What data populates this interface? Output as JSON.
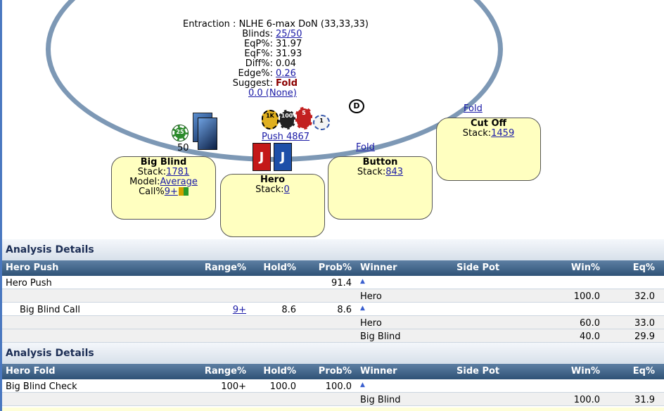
{
  "table": {
    "title_label": "Entraction :",
    "title_value": "NLHE 6-max DoN (33,33,33)",
    "stats": [
      {
        "label": "Blinds:",
        "value": "25/50",
        "link": true
      },
      {
        "label": "EqP%:",
        "value": "31.97",
        "link": false
      },
      {
        "label": "EqF%:",
        "value": "31.93",
        "link": false
      },
      {
        "label": "Diff%:",
        "value": "0.04",
        "link": false
      },
      {
        "label": "Edge%:",
        "value": "0.26",
        "link": true
      }
    ],
    "suggest_label": "Suggest:",
    "suggest_value": "Fold",
    "suggest_sub": "0.0 (None)",
    "dealer": "D",
    "push_label": "Push 4867",
    "bb_bet": "50",
    "chips": [
      "25",
      "1K",
      "100",
      "5",
      "1"
    ],
    "cards": [
      "J",
      "J"
    ],
    "colors": {
      "felt_border": "#7d98b5",
      "seat_bg": "#ffffc0",
      "link": "#1a1aa6",
      "suggest": "#8b0000"
    }
  },
  "seats": {
    "big_blind": {
      "name": "Big Blind",
      "stack_label": "Stack:",
      "stack": "1781",
      "model_label": "Model:",
      "model": "Average",
      "call_label": "Call%",
      "call": "9+"
    },
    "hero": {
      "name": "Hero",
      "stack_label": "Stack:",
      "stack": "0"
    },
    "button": {
      "name": "Button",
      "stack_label": "Stack:",
      "stack": "843",
      "action": "Fold"
    },
    "cutoff": {
      "name": "Cut Off",
      "stack_label": "Stack:",
      "stack": "1459",
      "action": "Fold"
    }
  },
  "analysis1": {
    "title": "Analysis Details",
    "headers": [
      "Hero Push",
      "Range%",
      "Hold%",
      "Prob%",
      "Winner",
      "Side Pot",
      "Win%",
      "Eq%"
    ],
    "rows": [
      {
        "c0": "Hero Push",
        "c1": "",
        "c2": "",
        "c3": "91.4",
        "c4": "▲",
        "c5": "",
        "c6": "",
        "c7": ""
      },
      {
        "c0": "",
        "c1": "",
        "c2": "",
        "c3": "",
        "c4": "Hero",
        "c5": "",
        "c6": "100.0",
        "c7": "32.0"
      },
      {
        "c0": "Big Blind Call",
        "c1": "9+",
        "c2": "8.6",
        "c3": "8.6",
        "c4": "▲",
        "c5": "",
        "c6": "",
        "c7": ""
      },
      {
        "c0": "",
        "c1": "",
        "c2": "",
        "c3": "",
        "c4": "Hero",
        "c5": "",
        "c6": "60.0",
        "c7": "33.0"
      },
      {
        "c0": "",
        "c1": "",
        "c2": "",
        "c3": "",
        "c4": "Big Blind",
        "c5": "",
        "c6": "40.0",
        "c7": "29.9"
      }
    ]
  },
  "analysis2": {
    "title": "Analysis Details",
    "headers": [
      "Hero Fold",
      "Range%",
      "Hold%",
      "Prob%",
      "Winner",
      "Side Pot",
      "Win%",
      "Eq%"
    ],
    "rows": [
      {
        "c0": "Big Blind Check",
        "c1": "100+",
        "c2": "100.0",
        "c3": "100.0",
        "c4": "▲",
        "c5": "",
        "c6": "",
        "c7": ""
      },
      {
        "c0": "",
        "c1": "",
        "c2": "",
        "c3": "",
        "c4": "Big Blind",
        "c5": "",
        "c6": "100.0",
        "c7": "31.9"
      }
    ]
  }
}
